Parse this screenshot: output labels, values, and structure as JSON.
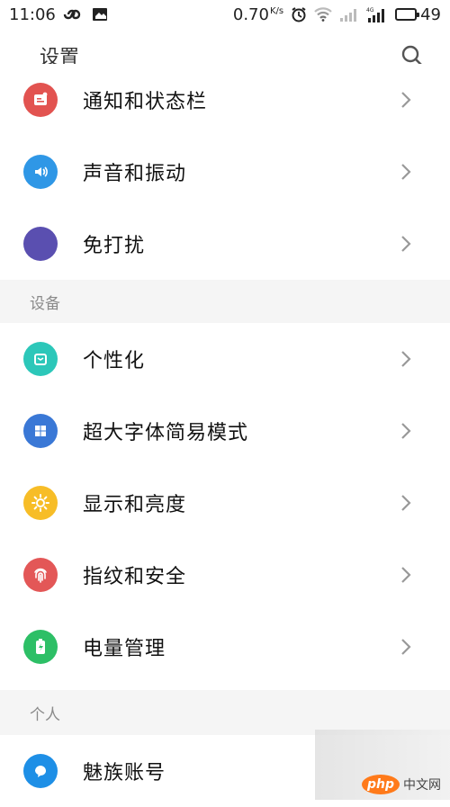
{
  "status_bar": {
    "time": "11:06",
    "net_speed_value": "0.70",
    "net_speed_unit": "K/s",
    "battery": "49",
    "battery_level": 0.49
  },
  "header": {
    "title": "设置"
  },
  "groups": [
    {
      "header": null,
      "items": [
        {
          "label": "通知和状态栏",
          "icon": "notification-icon",
          "color": "#e25350"
        },
        {
          "label": "声音和振动",
          "icon": "speaker-icon",
          "color": "#2f97e6"
        },
        {
          "label": "免打扰",
          "icon": "moon-icon",
          "color": "#5a4fb0"
        }
      ]
    },
    {
      "header": "设备",
      "items": [
        {
          "label": "个性化",
          "icon": "theme-icon",
          "color": "#2cc7b9"
        },
        {
          "label": "超大字体简易模式",
          "icon": "grid-icon",
          "color": "#3a78d6"
        },
        {
          "label": "显示和亮度",
          "icon": "sun-icon",
          "color": "#f7bd27"
        },
        {
          "label": "指纹和安全",
          "icon": "fingerprint-icon",
          "color": "#e35757"
        },
        {
          "label": "电量管理",
          "icon": "battery-icon",
          "color": "#2dbf66"
        }
      ]
    },
    {
      "header": "个人",
      "items": [
        {
          "label": "魅族账号",
          "icon": "account-icon",
          "color": "#1e8fe6"
        }
      ]
    }
  ],
  "watermark": {
    "brand": "php",
    "text": "中文网"
  }
}
